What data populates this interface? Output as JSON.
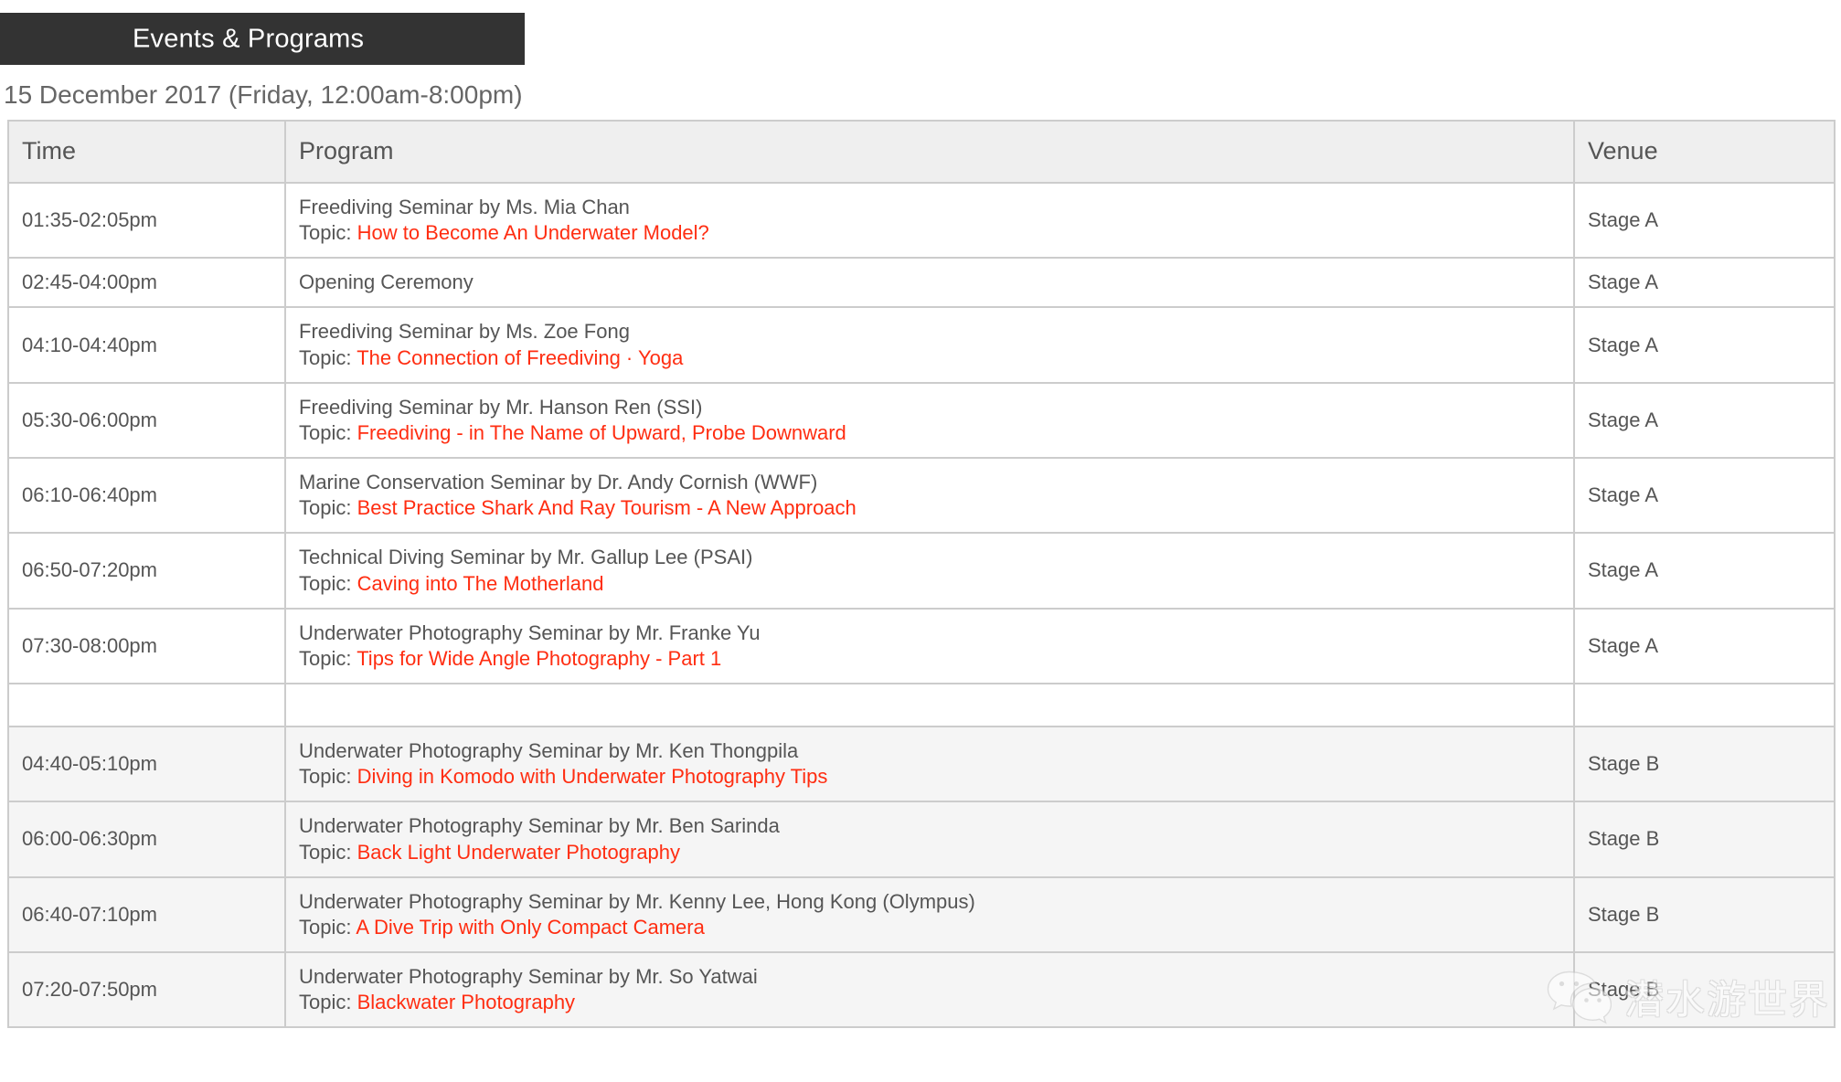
{
  "banner": {
    "title": "Events & Programs",
    "background_color": "#333333",
    "text_color": "#ffffff"
  },
  "date_heading": "15 December 2017 (Friday, 12:00am-8:00pm)",
  "colors": {
    "topic_red": "#ff2d11",
    "body_text": "#555555",
    "header_row_bg": "#efefef",
    "alt_row_bg": "#f5f5f5",
    "border": "#cccccc"
  },
  "table": {
    "columns": [
      {
        "key": "time",
        "label": "Time"
      },
      {
        "key": "program",
        "label": "Program"
      },
      {
        "key": "venue",
        "label": "Venue"
      }
    ],
    "topic_label": "Topic: ",
    "rows": [
      {
        "time": "01:35-02:05pm",
        "program_title": "Freediving Seminar by Ms. Mia Chan",
        "topic": "How to Become An Underwater Model?",
        "venue": "Stage A",
        "alt": false,
        "spacer": false
      },
      {
        "time": "02:45-04:00pm",
        "program_title": "Opening Ceremony",
        "topic": "",
        "venue": "Stage A",
        "alt": false,
        "spacer": false
      },
      {
        "time": "04:10-04:40pm",
        "program_title": "Freediving Seminar by Ms. Zoe Fong",
        "topic": "The Connection of Freediving · Yoga",
        "venue": "Stage A",
        "alt": false,
        "spacer": false
      },
      {
        "time": "05:30-06:00pm",
        "program_title": "Freediving Seminar by Mr. Hanson Ren (SSI)",
        "topic": "Freediving - in The Name of Upward, Probe Downward",
        "venue": "Stage A",
        "alt": false,
        "spacer": false
      },
      {
        "time": "06:10-06:40pm",
        "program_title": "Marine Conservation Seminar by Dr. Andy Cornish (WWF)",
        "topic": "Best Practice Shark And Ray Tourism - A New Approach",
        "venue": "Stage A",
        "alt": false,
        "spacer": false
      },
      {
        "time": "06:50-07:20pm",
        "program_title": "Technical Diving Seminar by Mr. Gallup Lee (PSAI)",
        "topic": "Caving into The Motherland",
        "venue": "Stage A",
        "alt": false,
        "spacer": false
      },
      {
        "time": "07:30-08:00pm",
        "program_title": "Underwater Photography Seminar by Mr. Franke Yu",
        "topic": "Tips for Wide Angle Photography - Part 1",
        "venue": "Stage A",
        "alt": false,
        "spacer": false
      },
      {
        "time": "",
        "program_title": "",
        "topic": "",
        "venue": "",
        "alt": false,
        "spacer": true
      },
      {
        "time": "04:40-05:10pm",
        "program_title": "Underwater Photography Seminar by Mr. Ken Thongpila",
        "topic": "Diving in Komodo with Underwater Photography Tips",
        "venue": "Stage B",
        "alt": true,
        "spacer": false
      },
      {
        "time": "06:00-06:30pm",
        "program_title": "Underwater Photography Seminar by Mr. Ben Sarinda",
        "topic": "Back Light Underwater Photography",
        "venue": "Stage B",
        "alt": true,
        "spacer": false
      },
      {
        "time": "06:40-07:10pm",
        "program_title": "Underwater Photography Seminar by Mr. Kenny Lee, Hong Kong (Olympus)",
        "topic": "A Dive Trip with Only Compact Camera",
        "venue": "Stage B",
        "alt": true,
        "spacer": false
      },
      {
        "time": "07:20-07:50pm",
        "program_title": "Underwater Photography Seminar by Mr. So Yatwai",
        "topic": "Blackwater Photography",
        "venue": "Stage B",
        "alt": true,
        "spacer": false
      }
    ]
  },
  "watermark": {
    "icon": "wechat-icon",
    "text": "潜水游世界"
  }
}
